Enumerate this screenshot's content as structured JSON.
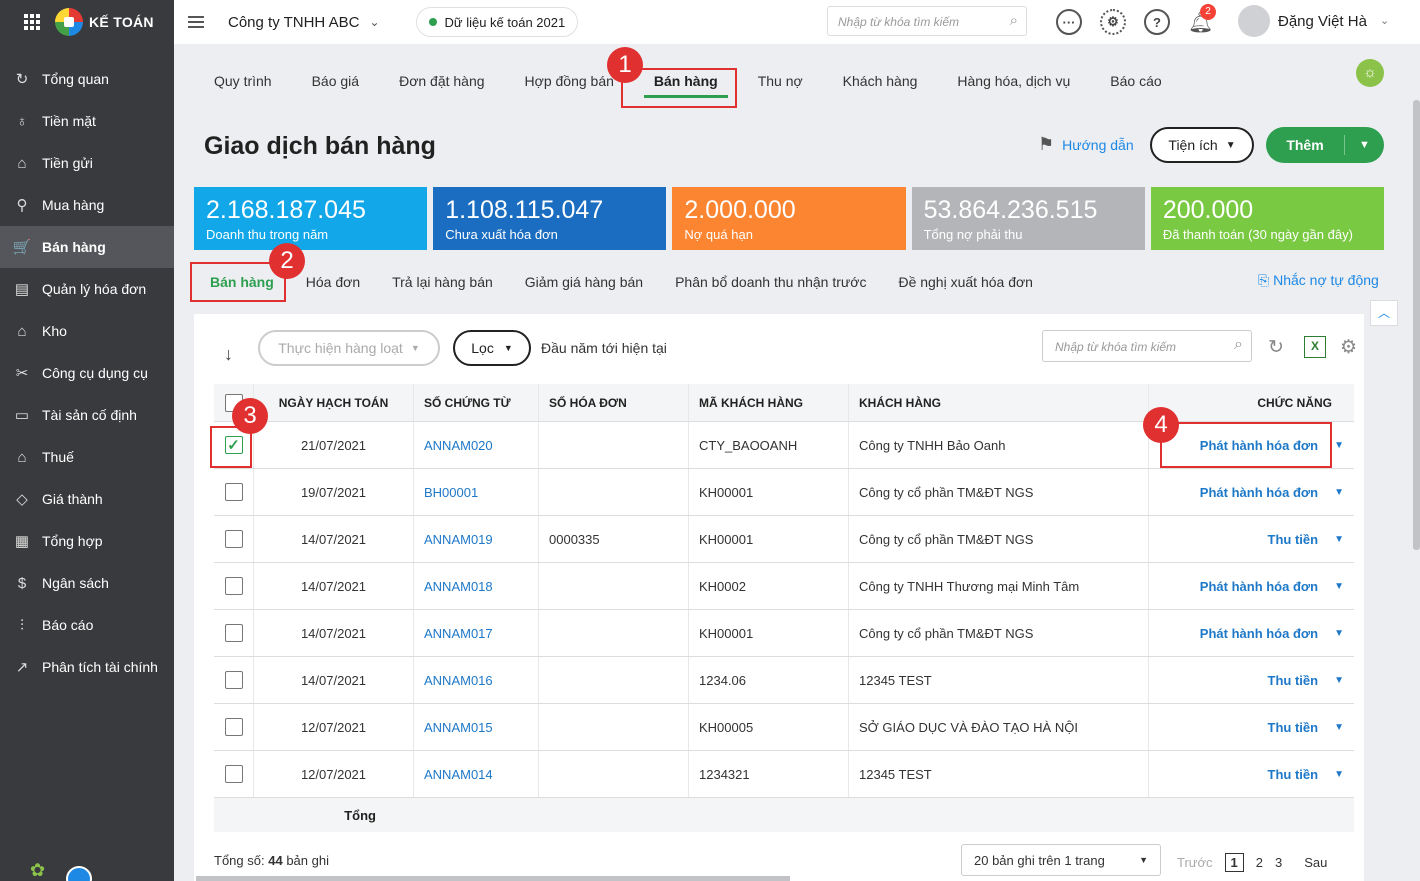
{
  "app": {
    "brand": "KẾ TOÁN"
  },
  "sidebar": {
    "items": [
      {
        "label": "Tổng quan",
        "icon": "↻"
      },
      {
        "label": "Tiền mặt",
        "icon": "♁"
      },
      {
        "label": "Tiền gửi",
        "icon": "⌂"
      },
      {
        "label": "Mua hàng",
        "icon": "⚲"
      },
      {
        "label": "Bán hàng",
        "icon": "🛒"
      },
      {
        "label": "Quản lý hóa đơn",
        "icon": "▤"
      },
      {
        "label": "Kho",
        "icon": "⌂"
      },
      {
        "label": "Công cụ dụng cụ",
        "icon": "✂"
      },
      {
        "label": "Tài sản cố định",
        "icon": "▭"
      },
      {
        "label": "Thuế",
        "icon": "⌂"
      },
      {
        "label": "Giá thành",
        "icon": "◇"
      },
      {
        "label": "Tổng hợp",
        "icon": "▦"
      },
      {
        "label": "Ngân sách",
        "icon": "$"
      },
      {
        "label": "Báo cáo",
        "icon": "⫶"
      },
      {
        "label": "Phân tích tài chính",
        "icon": "↗"
      }
    ]
  },
  "topbar": {
    "company": "Công ty TNHH ABC",
    "dataset": "Dữ liệu kế toán 2021",
    "search_placeholder": "Nhập từ khóa tìm kiếm",
    "notif_count": "2",
    "user_name": "Đặng Việt Hà"
  },
  "tabs": [
    "Quy trình",
    "Báo giá",
    "Đơn đặt hàng",
    "Hợp đồng bán",
    "Bán hàng",
    "Thu nợ",
    "Khách hàng",
    "Hàng hóa, dịch vụ",
    "Báo cáo"
  ],
  "page": {
    "title": "Giao dịch bán hàng",
    "guide": "Hướng dẫn",
    "utilities": "Tiện ích",
    "add": "Thêm"
  },
  "summary_cards": [
    {
      "value": "2.168.187.045",
      "label": "Doanh thu trong năm",
      "color": "#11a7e8"
    },
    {
      "value": "1.108.115.047",
      "label": "Chưa xuất hóa đơn",
      "color": "#1a6dc0"
    },
    {
      "value": "2.000.000",
      "label": "Nợ quá hạn",
      "color": "#fb8530"
    },
    {
      "value": "53.864.236.515",
      "label": "Tổng nợ phải thu",
      "color": "#b3b5b8"
    },
    {
      "value": "200.000",
      "label": "Đã thanh toán (30 ngày gần đây)",
      "color": "#7ac943"
    }
  ],
  "subtabs": [
    "Bán hàng",
    "Hóa đơn",
    "Trả lại hàng bán",
    "Giảm giá hàng bán",
    "Phân bổ doanh thu nhận trước",
    "Đề nghị xuất hóa đơn"
  ],
  "remind": "Nhắc nợ tự động",
  "toolbar": {
    "bulk": "Thực hiện hàng loạt",
    "filter": "Lọc",
    "period": "Đầu năm tới hiện tại",
    "search_placeholder": "Nhập từ khóa tìm kiếm"
  },
  "table": {
    "headers": [
      "NGÀY HẠCH TOÁN",
      "SỐ CHỨNG TỪ",
      "SỐ HÓA ĐƠN",
      "MÃ KHÁCH HÀNG",
      "KHÁCH HÀNG",
      "CHỨC NĂNG"
    ],
    "rows": [
      {
        "checked": true,
        "date": "21/07/2021",
        "doc": "ANNAM020",
        "invoice": "",
        "code": "CTY_BAOOANH",
        "customer": "Công ty TNHH Bảo Oanh",
        "action": "Phát hành hóa đơn"
      },
      {
        "checked": false,
        "date": "19/07/2021",
        "doc": "BH00001",
        "invoice": "",
        "code": "KH00001",
        "customer": "Công ty cổ phần TM&ĐT NGS",
        "action": "Phát hành hóa đơn"
      },
      {
        "checked": false,
        "date": "14/07/2021",
        "doc": "ANNAM019",
        "invoice": "0000335",
        "code": "KH00001",
        "customer": "Công ty cổ phần TM&ĐT NGS",
        "action": "Thu tiền"
      },
      {
        "checked": false,
        "date": "14/07/2021",
        "doc": "ANNAM018",
        "invoice": "",
        "code": "KH0002",
        "customer": "Công ty TNHH Thương mại Minh Tâm",
        "action": "Phát hành hóa đơn"
      },
      {
        "checked": false,
        "date": "14/07/2021",
        "doc": "ANNAM017",
        "invoice": "",
        "code": "KH00001",
        "customer": "Công ty cổ phần TM&ĐT NGS",
        "action": "Phát hành hóa đơn"
      },
      {
        "checked": false,
        "date": "14/07/2021",
        "doc": "ANNAM016",
        "invoice": "",
        "code": "1234.06",
        "customer": "12345 TEST",
        "action": "Thu tiền"
      },
      {
        "checked": false,
        "date": "12/07/2021",
        "doc": "ANNAM015",
        "invoice": "",
        "code": "KH00005",
        "customer": "SỞ GIÁO DỤC VÀ ĐÀO TẠO HÀ NỘI",
        "action": "Thu tiền"
      },
      {
        "checked": false,
        "date": "12/07/2021",
        "doc": "ANNAM014",
        "invoice": "",
        "code": "1234321",
        "customer": "12345 TEST",
        "action": "Thu tiền"
      }
    ],
    "total_label": "Tổng"
  },
  "footer": {
    "count_prefix": "Tổng số:",
    "count": "44",
    "count_suffix": "bản ghi",
    "page_size": "20 bản ghi trên 1 trang",
    "prev": "Trước",
    "pages": [
      "1",
      "2",
      "3"
    ],
    "next": "Sau"
  },
  "annotations": [
    "1",
    "2",
    "3",
    "4"
  ]
}
